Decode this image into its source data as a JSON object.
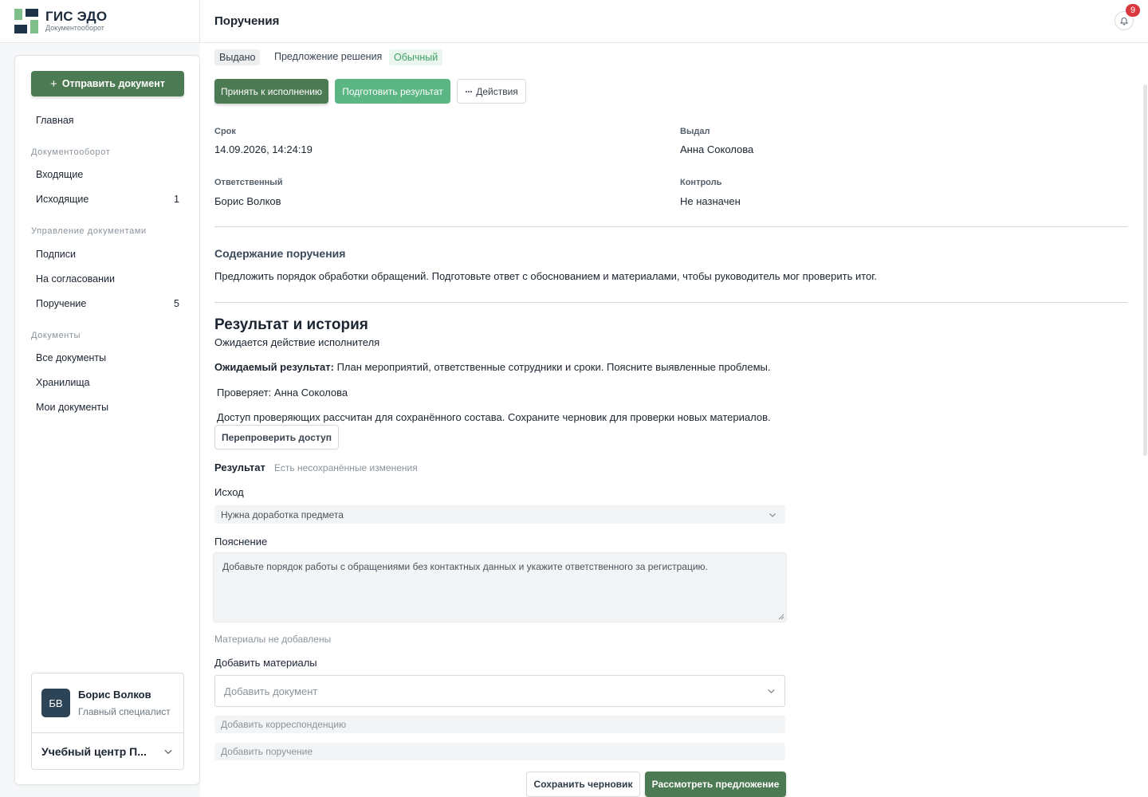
{
  "brand": {
    "title": "ГИС ЭДО",
    "subtitle": "Документооборот"
  },
  "header": {
    "title": "Поручения",
    "notifications_count": "9"
  },
  "sidebar": {
    "send_button": "Отправить документ",
    "home": "Главная",
    "groups": {
      "docflow": {
        "title": "Документооборот",
        "items": [
          {
            "label": "Входящие",
            "count": ""
          },
          {
            "label": "Исходящие",
            "count": "1"
          }
        ]
      },
      "management": {
        "title": "Управление документами",
        "items": [
          {
            "label": "Подписи",
            "count": ""
          },
          {
            "label": "На согласовании",
            "count": ""
          },
          {
            "label": "Поручение",
            "count": "5"
          }
        ]
      },
      "documents": {
        "title": "Документы",
        "items": [
          {
            "label": "Все документы",
            "count": ""
          },
          {
            "label": "Хранилища",
            "count": ""
          },
          {
            "label": "Мои документы",
            "count": ""
          }
        ]
      }
    },
    "user": {
      "initials": "БВ",
      "name": "Борис Волков",
      "role": "Главный специалист",
      "org": "Учебный центр П..."
    }
  },
  "task": {
    "status": "Выдано",
    "type": "Предложение решения",
    "priority": "Обычный",
    "actions": {
      "accept": "Принять к исполнению",
      "prepare": "Подготовить результат",
      "more": "Действия"
    },
    "fields": {
      "deadline_label": "Срок",
      "deadline_value": "14.09.2026, 14:24:19",
      "issuer_label": "Выдал",
      "issuer_value": "Анна Соколова",
      "responsible_label": "Ответственный",
      "responsible_value": "Борис Волков",
      "control_label": "Контроль",
      "control_value": "Не назначен"
    },
    "content_title": "Содержание поручения",
    "content_text": "Предложить порядок обработки обращений. Подготовьте ответ с обоснованием и материалами, чтобы руководитель мог проверить итог."
  },
  "result": {
    "title": "Результат и история",
    "awaiting": "Ожидается действие исполнителя",
    "expected_label": "Ожидаемый результат:",
    "expected_text": "План мероприятий, ответственные сотрудники и сроки. Поясните выявленные проблемы.",
    "reviewer": "Проверяет: Анна Соколова",
    "access_note": "Доступ проверяющих рассчитан для сохранённого состава. Сохраните черновик для проверки новых материалов.",
    "recheck_button": "Перепроверить доступ",
    "form_title": "Результат",
    "unsaved": "Есть несохранённые изменения",
    "outcome_label": "Исход",
    "outcome_value": "Нужна доработка предмета",
    "explanation_label": "Пояснение",
    "explanation_value": "Добавьте порядок работы с обращениями без контактных данных и укажите ответственного за регистрацию.",
    "materials_empty": "Материалы не добавлены",
    "add_materials_label": "Добавить материалы",
    "add_document_placeholder": "Добавить документ",
    "add_correspondence_placeholder": "Добавить корреспонденцию",
    "add_task_placeholder": "Добавить поручение",
    "save_draft": "Сохранить черновик",
    "review_proposal": "Рассмотреть предложение"
  },
  "colors": {
    "primary": "#4c7a52",
    "primary_light": "#5cb684",
    "success_text": "#3fa164",
    "badge": "#d9393e"
  }
}
